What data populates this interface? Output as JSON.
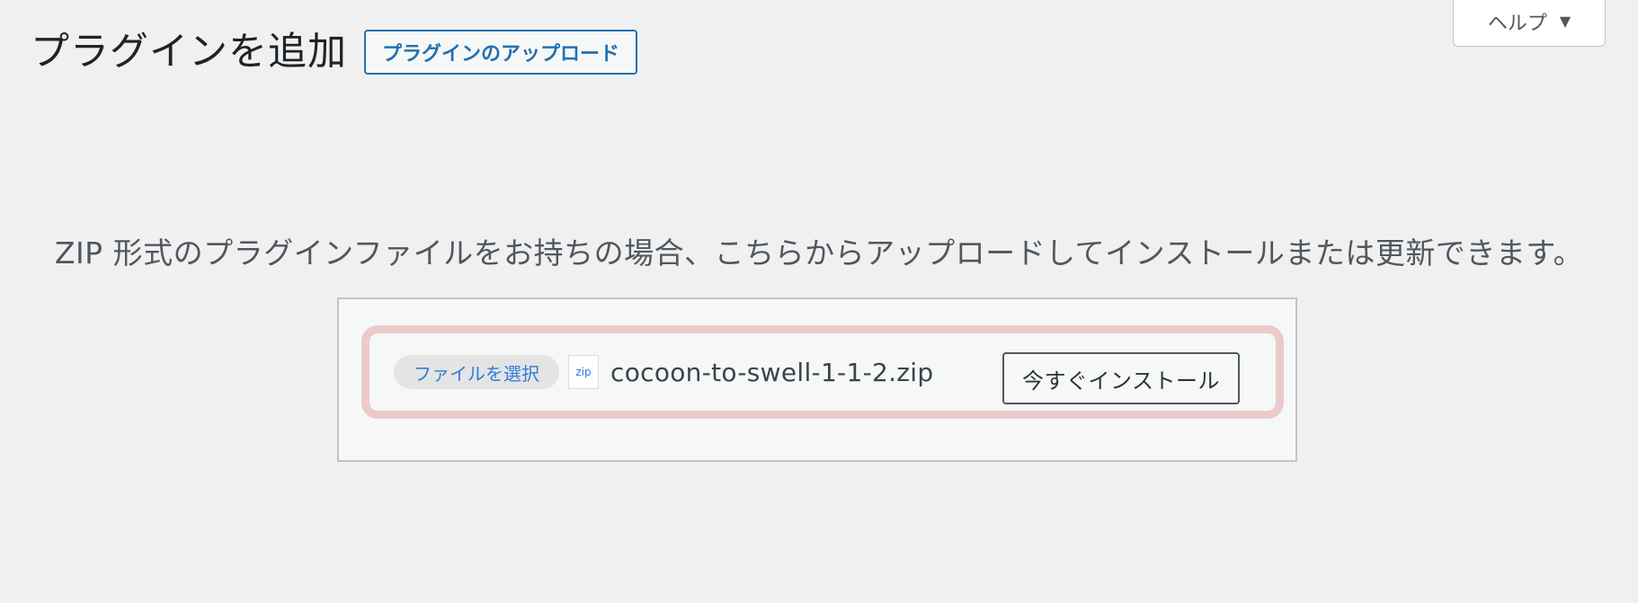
{
  "header": {
    "title": "プラグインを追加",
    "upload_button_label": "プラグインのアップロード"
  },
  "help": {
    "label": "ヘルプ",
    "arrow_icon": "▼"
  },
  "upload": {
    "description": "ZIP 形式のプラグインファイルをお持ちの場合、こちらからアップロードしてインストールまたは更新できます。",
    "choose_file_label": "ファイルを選択",
    "file_icon_label": "zip",
    "file_name": "cocoon-to-swell-1-1-2.zip",
    "install_button_label": "今すぐインストール"
  },
  "colors": {
    "accent": "#2271b1",
    "highlight": "#ebcaca",
    "background": "#f0f0f1"
  }
}
